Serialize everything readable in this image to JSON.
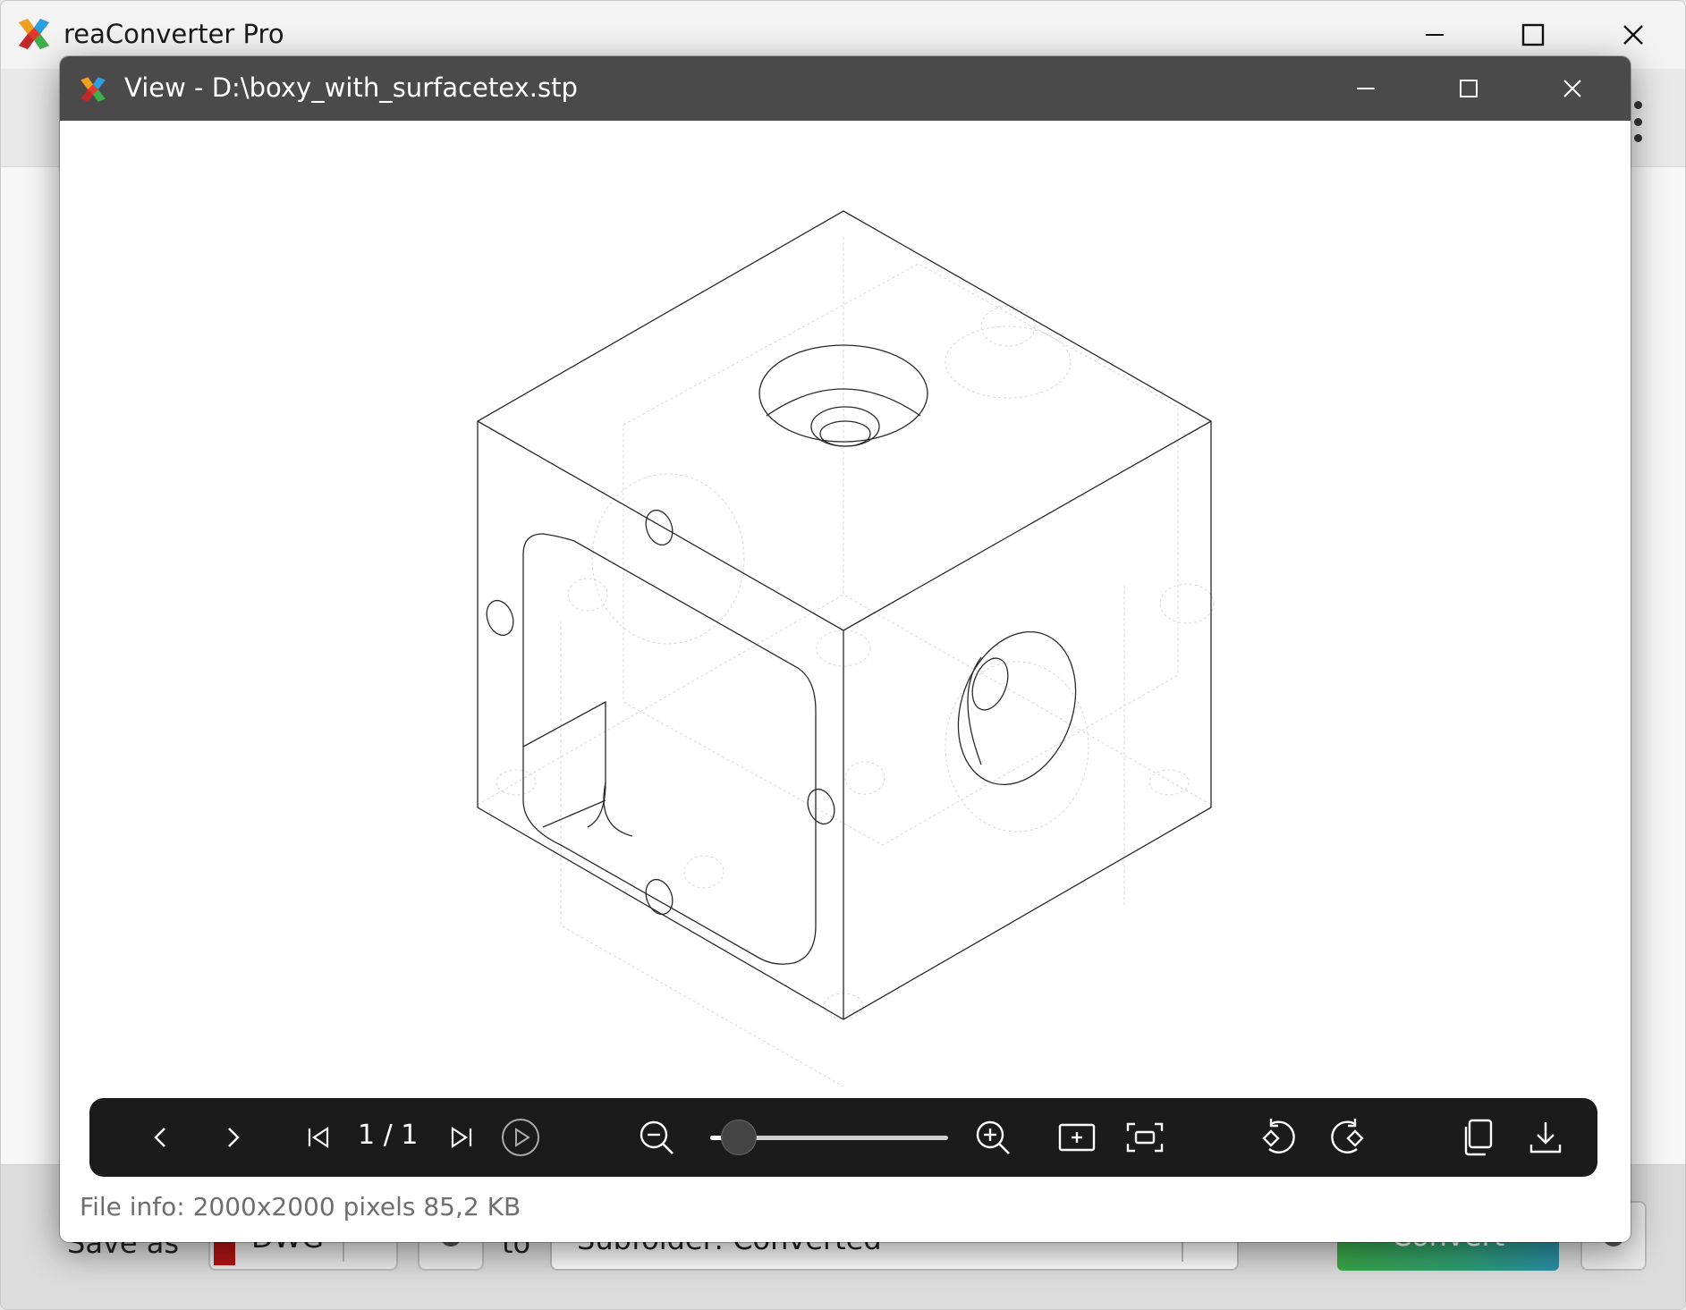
{
  "app": {
    "title": "reaConverter Pro",
    "bottom_bar": {
      "save_as_label": "Save as",
      "format_value": "DWG",
      "format_color": "#b01515",
      "to_label": "to",
      "destination_value": "Subfolder: Converted",
      "convert_label": "Convert"
    }
  },
  "viewer": {
    "title": "View - D:\\boxy_with_surfacetex.stp",
    "page_counter": "1 / 1",
    "zoom_level_fraction": 0.12,
    "file_info": "File info: 2000x2000 pixels 85,2 KB",
    "toolbar_icons": [
      "chevron-left-icon",
      "chevron-right-icon",
      "first-page-icon",
      "last-page-icon",
      "play-icon",
      "zoom-out-icon",
      "zoom-in-icon",
      "fit-screen-icon",
      "actual-size-icon",
      "rotate-left-icon",
      "rotate-right-icon",
      "copy-icon",
      "download-icon"
    ]
  },
  "colors": {
    "viewer_titlebar": "#4a4a4a",
    "toolbar_bg": "#1b1b1b",
    "convert_gradient_start": "#3aa84a",
    "convert_gradient_end": "#2a8fa8"
  }
}
